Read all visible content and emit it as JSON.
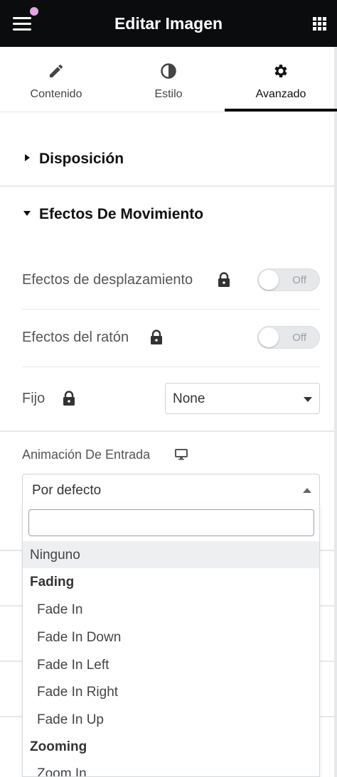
{
  "header": {
    "title": "Editar Imagen"
  },
  "tabs": [
    {
      "label": "Contenido",
      "icon": "pencil-icon"
    },
    {
      "label": "Estilo",
      "icon": "half-circle-icon"
    },
    {
      "label": "Avanzado",
      "icon": "gear-icon",
      "active": true
    }
  ],
  "sections": {
    "layout": {
      "title": "Disposición"
    },
    "motion": {
      "title": "Efectos De Movimiento"
    }
  },
  "controls": {
    "scroll_effects": {
      "label": "Efectos de desplazamiento",
      "toggle": "Off"
    },
    "mouse_effects": {
      "label": "Efectos del ratón",
      "toggle": "Off"
    },
    "sticky": {
      "label": "Fijo",
      "value": "None"
    },
    "entrance_animation": {
      "label": "Animación De Entrada",
      "value": "Por defecto"
    }
  },
  "dropdown": {
    "search_value": "",
    "items": [
      {
        "label": "Ninguno",
        "type": "option",
        "highlighted": true
      },
      {
        "label": "Fading",
        "type": "group"
      },
      {
        "label": "Fade In",
        "type": "option"
      },
      {
        "label": "Fade In Down",
        "type": "option"
      },
      {
        "label": "Fade In Left",
        "type": "option"
      },
      {
        "label": "Fade In Right",
        "type": "option"
      },
      {
        "label": "Fade In Up",
        "type": "option"
      },
      {
        "label": "Zooming",
        "type": "group"
      },
      {
        "label": "Zoom In",
        "type": "option"
      }
    ]
  },
  "colors": {
    "header_bg": "#0b0c0d",
    "notification_dot": "#e7a2e0",
    "divider": "#e6e8ea",
    "highlight": "#eeeff0"
  }
}
